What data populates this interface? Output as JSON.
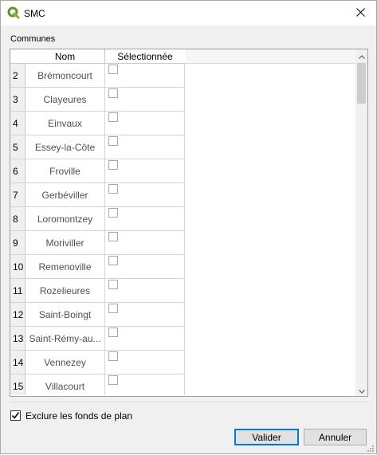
{
  "window": {
    "title": "SMC",
    "app_icon": "qgis-icon",
    "accent_color": "#0078d7"
  },
  "group": {
    "label": "Communes"
  },
  "table": {
    "columns": [
      "Nom",
      "Sélectionnée"
    ],
    "rows": [
      {
        "num": "2",
        "nom": "Brémoncourt",
        "selected": false
      },
      {
        "num": "3",
        "nom": "Clayeures",
        "selected": false
      },
      {
        "num": "4",
        "nom": "Einvaux",
        "selected": false
      },
      {
        "num": "5",
        "nom": "Essey-la-Côte",
        "selected": false
      },
      {
        "num": "6",
        "nom": "Froville",
        "selected": false
      },
      {
        "num": "7",
        "nom": "Gerbéviller",
        "selected": false
      },
      {
        "num": "8",
        "nom": "Loromontzey",
        "selected": false
      },
      {
        "num": "9",
        "nom": "Moriviller",
        "selected": false
      },
      {
        "num": "10",
        "nom": "Remenoville",
        "selected": false
      },
      {
        "num": "11",
        "nom": "Rozelieures",
        "selected": false
      },
      {
        "num": "12",
        "nom": "Saint-Boingt",
        "selected": false
      },
      {
        "num": "13",
        "nom": "Saint-Rémy-au...",
        "selected": false
      },
      {
        "num": "14",
        "nom": "Vennezey",
        "selected": false
      },
      {
        "num": "15",
        "nom": "Villacourt",
        "selected": false
      }
    ]
  },
  "options": {
    "exclude_label": "Exclure les fonds de plan",
    "exclude_checked": true
  },
  "buttons": {
    "ok_label": "Valider",
    "cancel_label": "Annuler"
  }
}
